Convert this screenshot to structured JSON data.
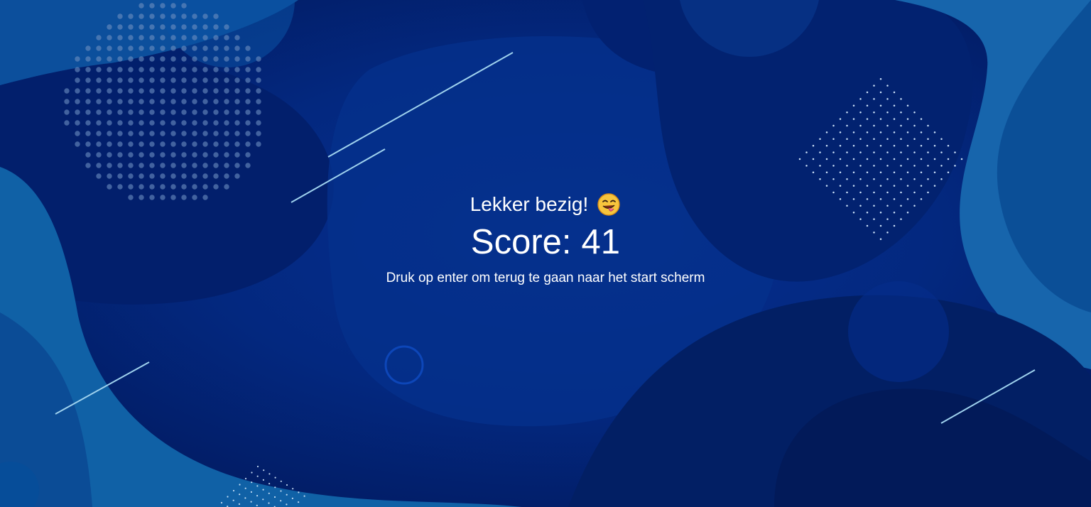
{
  "result_screen": {
    "message": "Lekker bezig!",
    "message_icon": "winking-face-with-tongue-icon",
    "score_label": "Score:",
    "score_value": "41",
    "hint": "Druk op enter om terug te gaan naar het start scherm"
  },
  "colors": {
    "background": "#03277f",
    "background_dark": "#021c65",
    "background_light": "#1168ad",
    "text": "#ffffff",
    "accent_line": "#9fd2ee"
  }
}
